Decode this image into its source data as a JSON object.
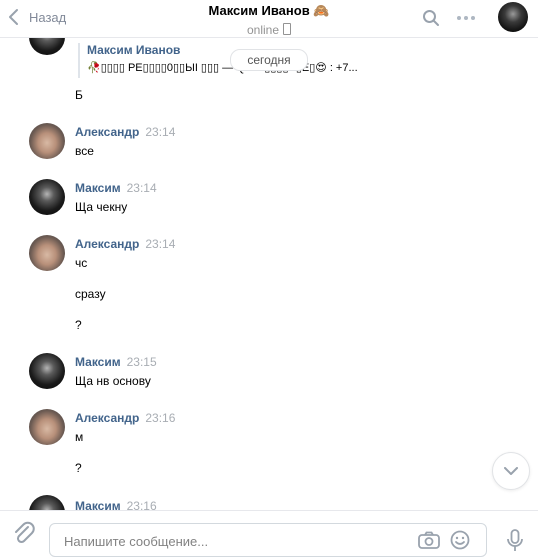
{
  "header": {
    "back_label": "Назад",
    "title": "Максим Иванов",
    "title_emoji": "🙈",
    "status": "online"
  },
  "date_pill": "сегодня",
  "quote": {
    "name": "Максим Иванов",
    "text": "🥀▯▯▯▯ PE▯▯▯▯0▯▯ЫI ▯▯▯   — QIWI ▯▯▯▯E▯E▯😍 : +7..."
  },
  "messages": [
    {
      "type": "text",
      "text": "Б"
    },
    {
      "type": "msg",
      "name": "Александр",
      "time": "23:14",
      "lines": [
        "все"
      ]
    },
    {
      "type": "msg",
      "name": "Максим",
      "time": "23:14",
      "lines": [
        "Ща чекну"
      ]
    },
    {
      "type": "msg",
      "name": "Александр",
      "time": "23:14",
      "lines": [
        "чс",
        "сразу",
        "?"
      ]
    },
    {
      "type": "msg",
      "name": "Максим",
      "time": "23:15",
      "lines": [
        "Ща нв основу"
      ]
    },
    {
      "type": "msg",
      "name": "Александр",
      "time": "23:16",
      "lines": [
        "м",
        "?"
      ]
    },
    {
      "type": "msg",
      "name": "Максим",
      "time": "23:16",
      "lines": []
    }
  ],
  "composer": {
    "placeholder": "Напишите сообщение..."
  }
}
